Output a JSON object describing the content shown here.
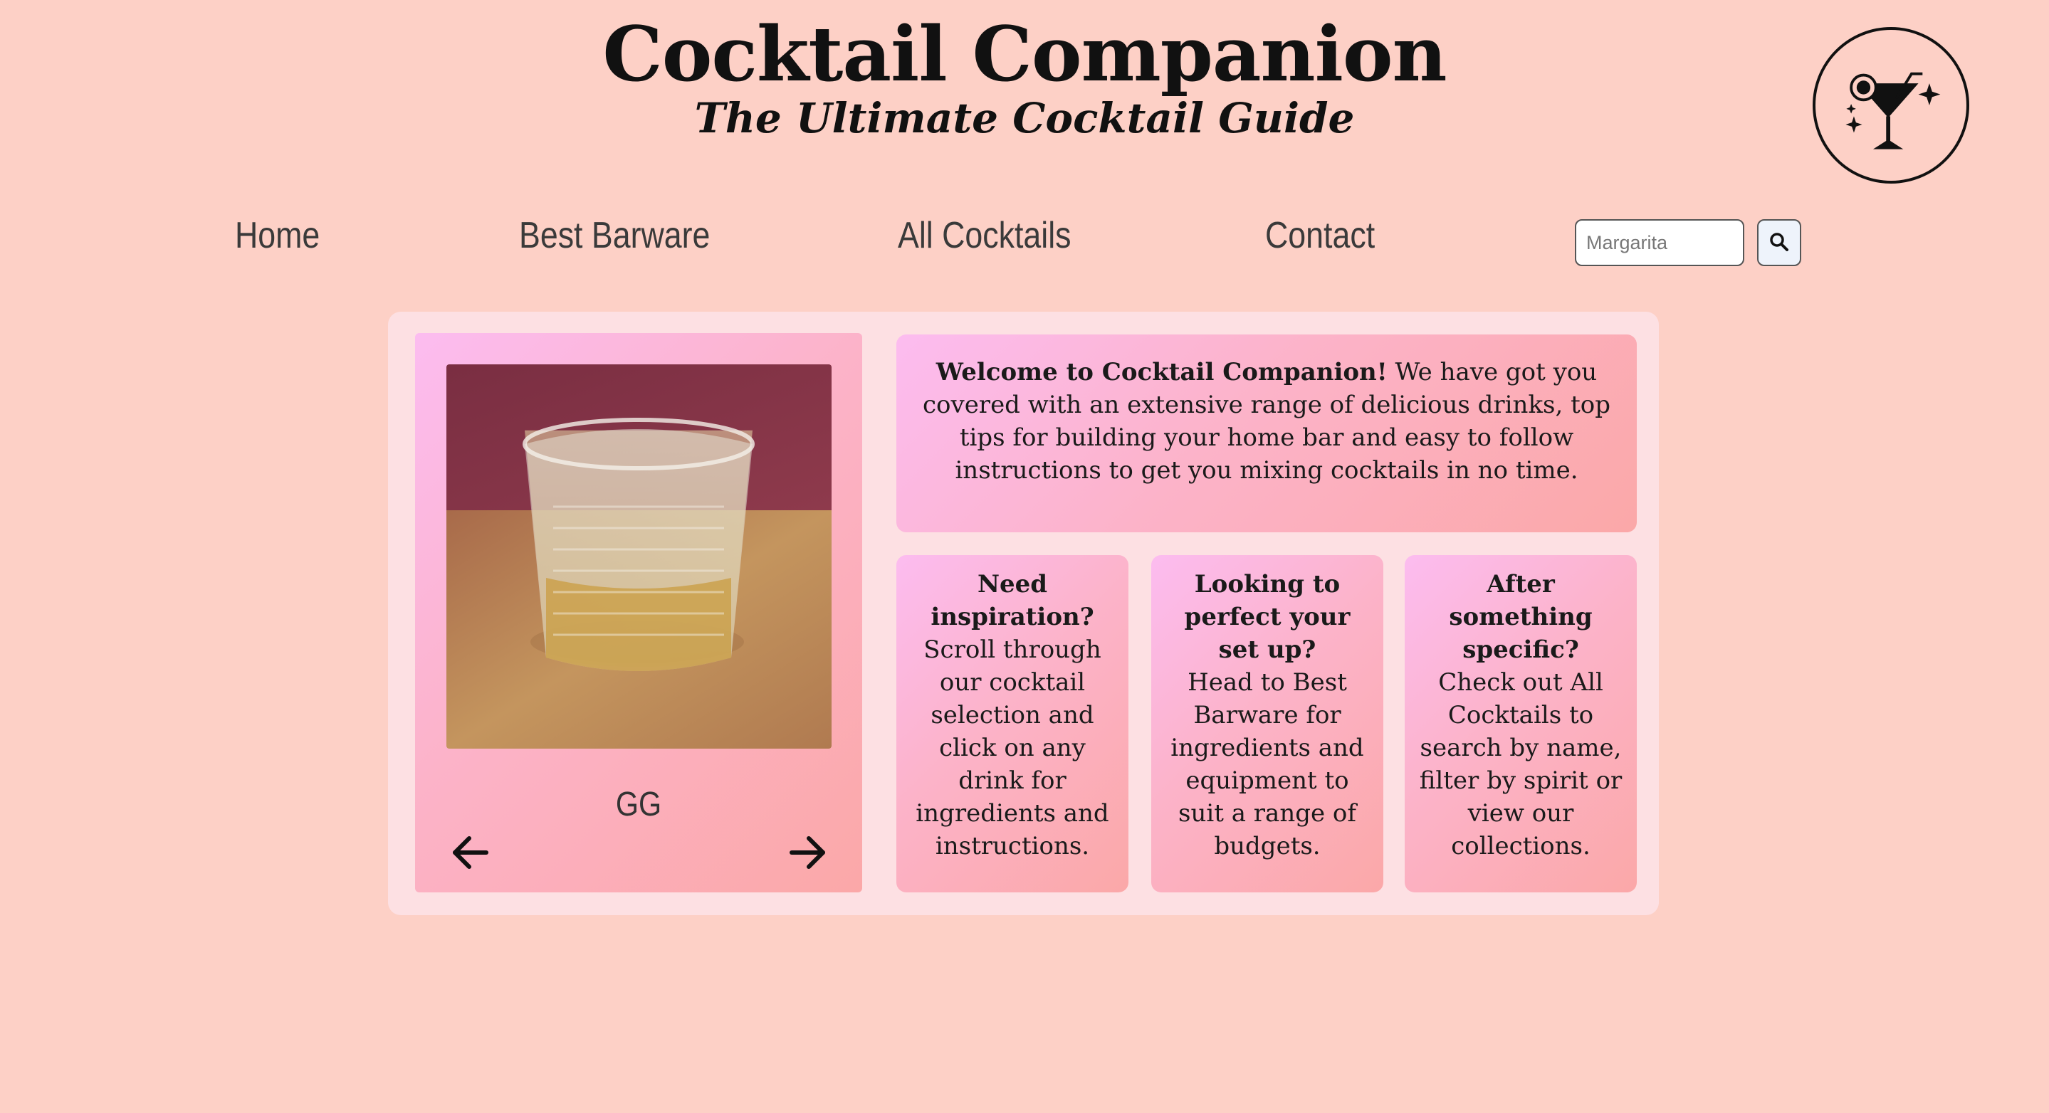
{
  "header": {
    "title": "Cocktail Companion",
    "subtitle": "The Ultimate Cocktail Guide",
    "logo_icon": "cocktail-glass-icon"
  },
  "nav": {
    "items": [
      {
        "label": "Home"
      },
      {
        "label": "Best Barware"
      },
      {
        "label": "All Cocktails"
      },
      {
        "label": "Contact"
      }
    ],
    "search": {
      "placeholder": "Margarita",
      "value": "",
      "button_icon": "search-icon"
    }
  },
  "carousel": {
    "current_drink": "GG",
    "prev_icon": "arrow-left-icon",
    "next_icon": "arrow-right-icon"
  },
  "welcome": {
    "lead": "Welcome to Cocktail Companion!",
    "body": " We have got you covered with an extensive range of delicious drinks, top tips for building your home bar and easy to follow instructions to get you mixing cocktails in no time."
  },
  "info_cards": [
    {
      "heading": "Need inspiration?",
      "body": "Scroll through our cocktail selection and click on any drink for ingredients and instructions."
    },
    {
      "heading": "Looking to perfect your set up?",
      "body": "Head to Best Barware for ingredients and equipment to suit a range of budgets."
    },
    {
      "heading": "After something specific?",
      "body": "Check out All Cocktails to search by name, filter by spirit or view our collections."
    }
  ],
  "colors": {
    "page_background": "#fdd0c6",
    "panel_background": "#fde0e3",
    "card_gradient_start": "#fcbcf0",
    "card_gradient_end": "#fba8a8",
    "nav_text": "#3a3a3a"
  }
}
